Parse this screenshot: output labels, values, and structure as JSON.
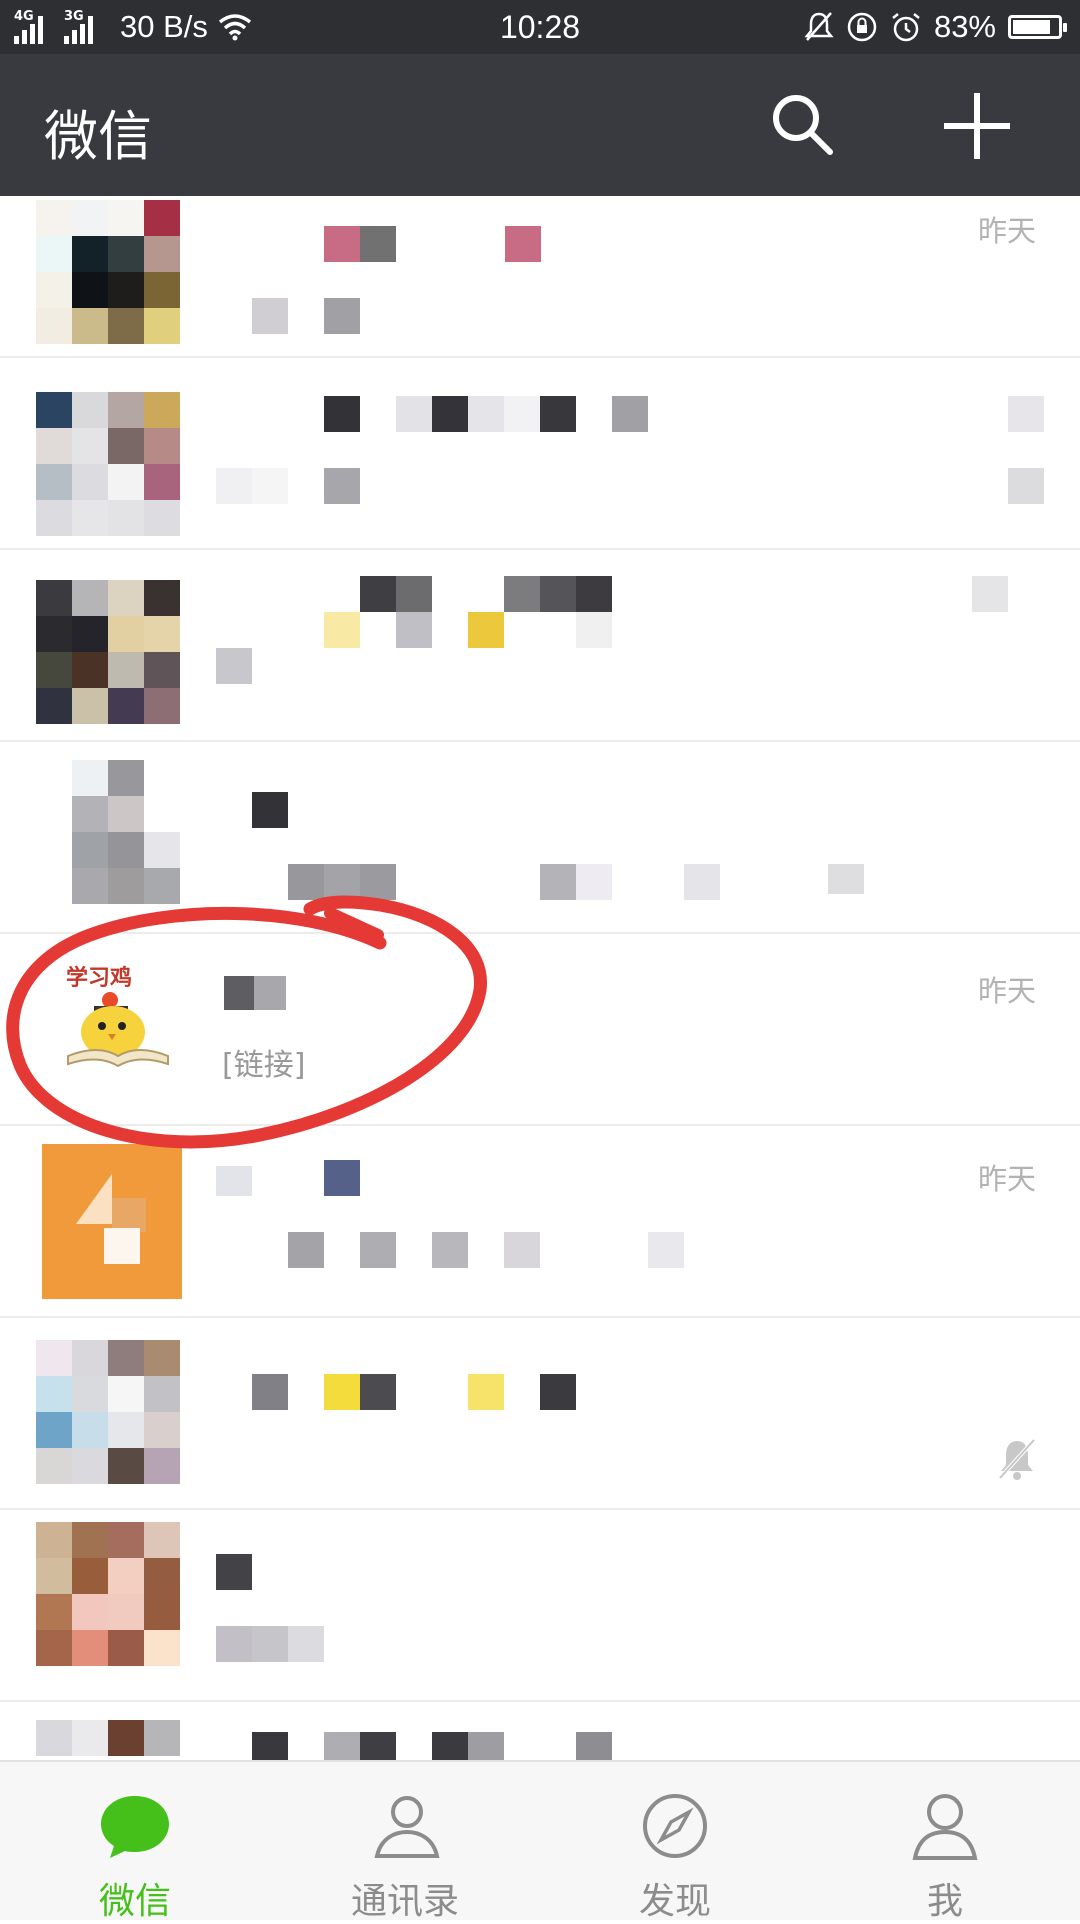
{
  "status_bar": {
    "network_1": "4G",
    "network_2": "3G",
    "speed": "30 B/s",
    "time": "10:28",
    "battery": "83%",
    "battery_level": 0.83
  },
  "app_bar": {
    "title": "微信",
    "search_icon": "search-icon",
    "add_icon": "plus-icon"
  },
  "chats": [
    {
      "time": "昨天",
      "avatar": "pixelated-avatar",
      "muted": false
    },
    {
      "time": "",
      "avatar": "pixelated-avatar",
      "muted": false
    },
    {
      "time": "",
      "avatar": "pixelated-avatar",
      "muted": false
    },
    {
      "time": "",
      "avatar": "pixelated-avatar",
      "muted": false
    },
    {
      "time": "昨天",
      "avatar": "xuexiji-chick-avatar",
      "avatar_text": "学习鸡",
      "preview": "[链接]",
      "muted": false
    },
    {
      "time": "昨天",
      "avatar": "orange-logo-avatar",
      "muted": false
    },
    {
      "time": "",
      "avatar": "pixelated-avatar",
      "muted": true
    },
    {
      "time": "",
      "avatar": "pixelated-avatar",
      "muted": false
    },
    {
      "time": "",
      "avatar": "pixelated-avatar",
      "muted": false
    }
  ],
  "tabs": [
    {
      "label": "微信",
      "icon": "chat-bubble-icon",
      "active": true
    },
    {
      "label": "通讯录",
      "icon": "contacts-icon",
      "active": false
    },
    {
      "label": "发现",
      "icon": "compass-icon",
      "active": false
    },
    {
      "label": "我",
      "icon": "person-icon",
      "active": false
    }
  ],
  "colors": {
    "status_bar_bg": "#2e2f33",
    "app_bar_bg": "#393a3f",
    "active_tab": "#45c01a",
    "annotation": "#e53935"
  }
}
